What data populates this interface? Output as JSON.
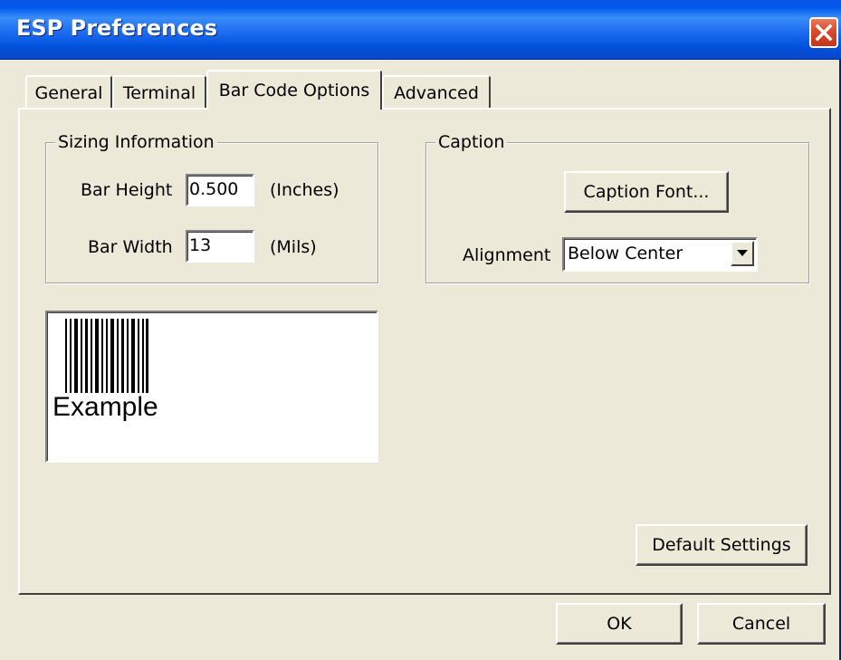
{
  "window": {
    "title": "ESP Preferences"
  },
  "tabs": [
    {
      "label": "General"
    },
    {
      "label": "Terminal"
    },
    {
      "label": "Bar Code Options"
    },
    {
      "label": "Advanced"
    }
  ],
  "sizing": {
    "title": "Sizing Information",
    "bar_height_label": "Bar Height",
    "bar_height_value": "0.500",
    "bar_height_unit": "(Inches)",
    "bar_width_label": "Bar Width",
    "bar_width_value": "13",
    "bar_width_unit": "(Mils)"
  },
  "caption": {
    "title": "Caption",
    "font_button": "Caption Font...",
    "alignment_label": "Alignment",
    "alignment_value": "Below Center"
  },
  "preview": {
    "example_text": "Example"
  },
  "buttons": {
    "default_settings": "Default Settings",
    "ok": "OK",
    "cancel": "Cancel"
  },
  "colors": {
    "titlebar": "#0058ee",
    "face": "#ece9d8",
    "close": "#d9492b"
  },
  "icons": {
    "close": "close-icon",
    "dropdown": "chevron-down-icon",
    "barcode": "barcode-icon"
  }
}
